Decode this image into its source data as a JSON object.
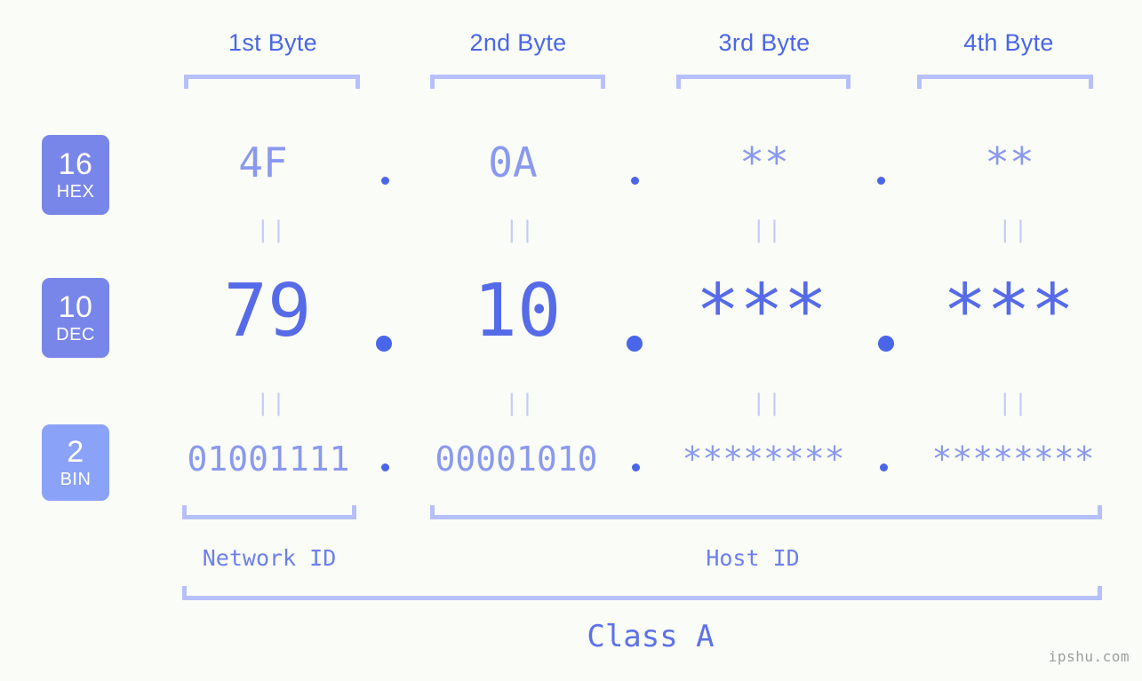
{
  "background_color": "#FAFCF7",
  "accent_color": "#4A66E8",
  "accent_light_color": "#8A99F0",
  "bracket_color": "#B7C0FB",
  "header": {
    "byte_labels": [
      {
        "label": "1st Byte"
      },
      {
        "label": "2nd Byte"
      },
      {
        "label": "3rd Byte"
      },
      {
        "label": "4th Byte"
      }
    ]
  },
  "radix_badges": [
    {
      "number": "16",
      "abbr": "HEX",
      "color": "#7986E9"
    },
    {
      "number": "10",
      "abbr": "DEC",
      "color": "#7986E9"
    },
    {
      "number": "2",
      "abbr": "BIN",
      "color": "#8BA2F9"
    }
  ],
  "rows": {
    "hex": {
      "values": [
        "4F",
        "0A",
        "**",
        "**"
      ],
      "separators": [
        ".",
        ".",
        "."
      ]
    },
    "dec": {
      "values": [
        "79",
        "10",
        "***",
        "***"
      ],
      "separators": [
        ".",
        ".",
        "."
      ]
    },
    "bin": {
      "values": [
        "01001111",
        "00001010",
        "********",
        "********"
      ],
      "separators": [
        ".",
        ".",
        "."
      ]
    }
  },
  "connectors": {
    "symbol": "||",
    "rows": 2,
    "columns": 4
  },
  "sections": [
    {
      "label": "Network ID"
    },
    {
      "label": "Host ID"
    }
  ],
  "class": {
    "label": "Class A"
  },
  "watermark": {
    "text": "ipshu.com"
  }
}
